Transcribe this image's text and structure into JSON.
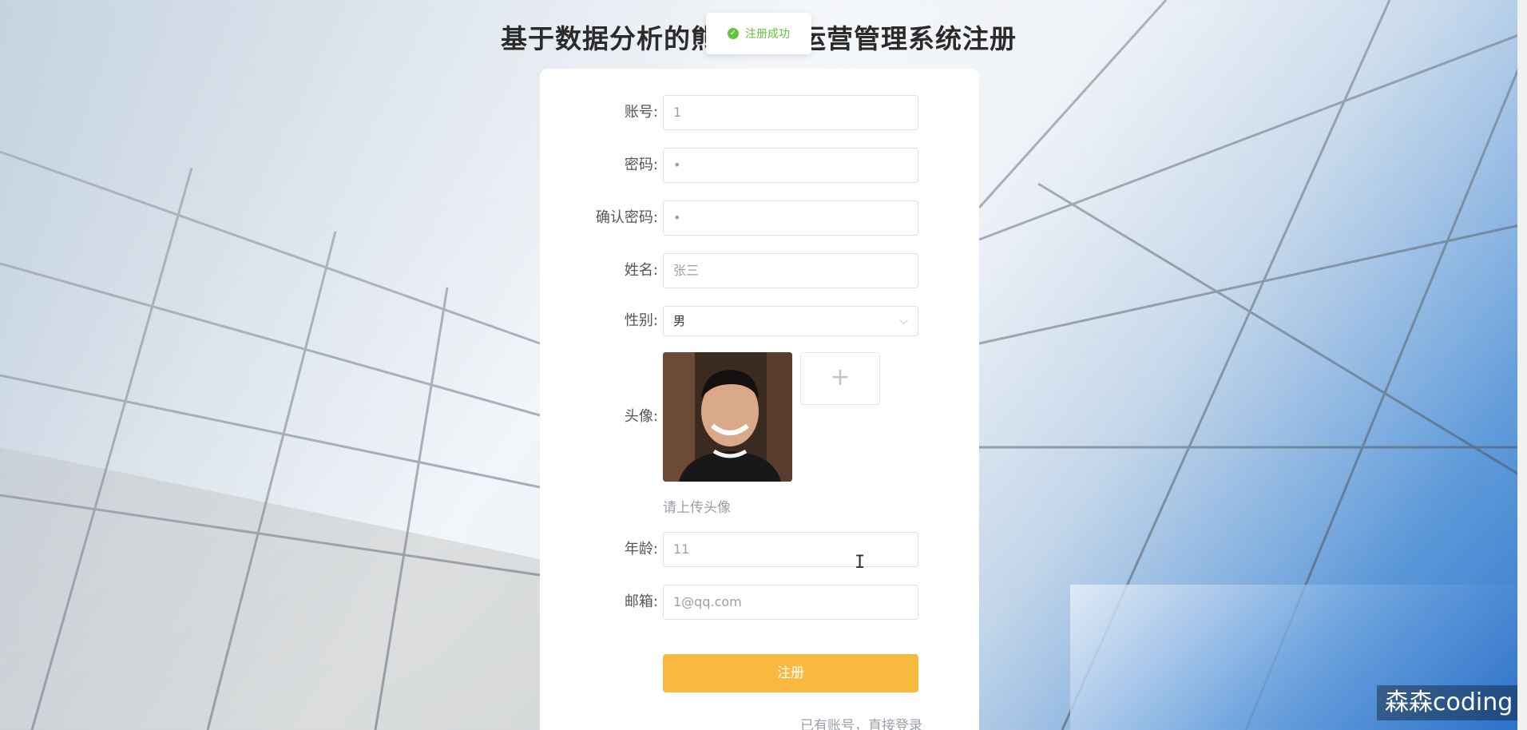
{
  "page": {
    "title": "基于数据分析的熊猫智慧运营管理系统注册"
  },
  "toast": {
    "text": "注册成功"
  },
  "form": {
    "account": {
      "label": "账号:",
      "value": "1"
    },
    "password": {
      "label": "密码:",
      "value": "•"
    },
    "confirm_password": {
      "label": "确认密码:",
      "value": "•"
    },
    "name": {
      "label": "姓名:",
      "placeholder": "张三"
    },
    "gender": {
      "label": "性别:",
      "value": "男"
    },
    "avatar": {
      "label": "头像:",
      "hint": "请上传头像"
    },
    "age": {
      "label": "年龄:",
      "value": "11"
    },
    "email": {
      "label": "邮箱:",
      "value": "1@qq.com"
    },
    "submit_label": "注册",
    "login_link": "已有账号，直接登录"
  },
  "watermark": "森森coding",
  "colors": {
    "accent": "#f9b93e",
    "success": "#67c23a"
  }
}
